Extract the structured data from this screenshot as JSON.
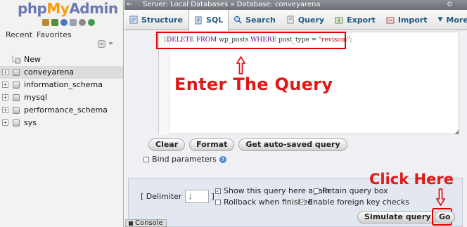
{
  "logo": {
    "php": "php",
    "my": "My",
    "admin": "Admin"
  },
  "nav": {
    "recent": "Recent",
    "favorites": "Favorites",
    "tree": [
      {
        "label": "New",
        "type": "new"
      },
      {
        "label": "conveyarena",
        "type": "db",
        "active": true
      },
      {
        "label": "information_schema",
        "type": "db"
      },
      {
        "label": "mysql",
        "type": "db"
      },
      {
        "label": "performance_schema",
        "type": "db"
      },
      {
        "label": "sys",
        "type": "db"
      }
    ]
  },
  "breadcrumb": {
    "back": "←",
    "text": "Server: Local Databases » Database: conveyarena",
    "gear": "⚙"
  },
  "tabs": [
    {
      "label": "Structure",
      "active": false
    },
    {
      "label": "SQL",
      "active": true
    },
    {
      "label": "Search",
      "active": false
    },
    {
      "label": "Query",
      "active": false
    },
    {
      "label": "Export",
      "active": false
    },
    {
      "label": "Import",
      "active": false
    },
    {
      "label": "More",
      "active": false
    }
  ],
  "editor": {
    "line_number": "1",
    "query_kw1": "DELETE FROM",
    "query_mid1": " wp_posts ",
    "query_kw2": "WHERE",
    "query_mid2": " post_type = ",
    "query_str": "\"revision\"",
    "query_end": ";"
  },
  "annotations": {
    "enter": "Enter The Query",
    "click": "Click Here",
    "color": "#e01818"
  },
  "editor_buttons": {
    "clear": "Clear",
    "format": "Format",
    "get_saved": "Get auto-saved query"
  },
  "bind_params": "Bind parameters",
  "options": {
    "delimiter_label": "[ Delimiter",
    "delimiter_value": ";",
    "delimiter_close": "]",
    "show_again": "Show this query here again",
    "retain_box": "Retain query box",
    "rollback": "Rollback when finished",
    "foreign_keys": "Enable foreign key checks"
  },
  "actions": {
    "simulate": "Simulate query",
    "go": "Go"
  },
  "console": "Console"
}
